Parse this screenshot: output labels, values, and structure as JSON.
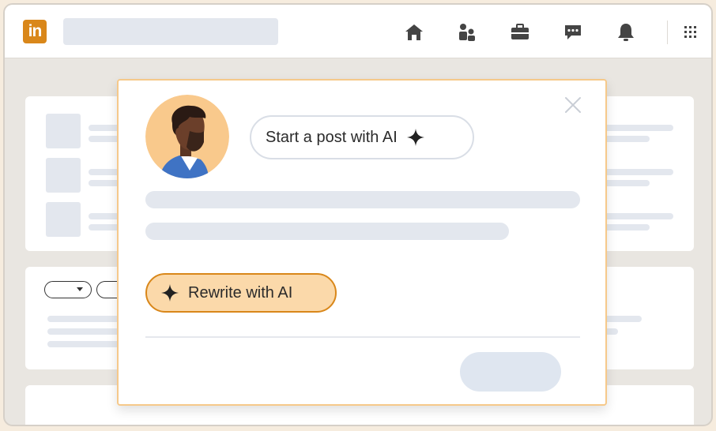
{
  "header": {
    "logo_text": "in",
    "icons": [
      "home-icon",
      "my-network-icon",
      "jobs-icon",
      "messaging-icon",
      "notifications-icon",
      "apps-grid-icon"
    ]
  },
  "modal": {
    "start_post_label": "Start a post with AI",
    "rewrite_label": "Rewrite with AI",
    "close_icon": "close-icon",
    "sparkle_icon": "sparkle-icon"
  },
  "colors": {
    "accent": "#d9871a",
    "accent_light": "#fbd9aa",
    "modal_border": "#f6c98a",
    "placeholder": "#e3e7ee"
  }
}
